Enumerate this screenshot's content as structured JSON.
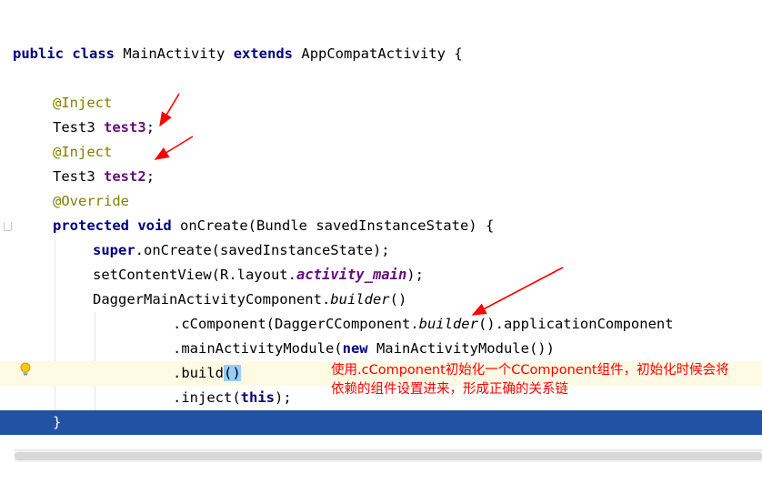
{
  "code": {
    "class_decl": {
      "kw1": "public",
      "kw2": "class",
      "name": "MainActivity",
      "kw3": "extends",
      "parent": "AppCompatActivity",
      "brace": "{"
    },
    "inject1": "@Inject",
    "field1": {
      "type": "Test3",
      "name": "test3",
      "semi": ";"
    },
    "inject2": "@Inject",
    "field2": {
      "type": "Test3",
      "name": "test2",
      "semi": ";"
    },
    "override": "@Override",
    "method_decl": {
      "kw1": "protected",
      "kw2": "void",
      "rest": "onCreate(Bundle savedInstanceState) {"
    },
    "super_call": {
      "kw": "super",
      "rest": ".onCreate(savedInstanceState);"
    },
    "set_content": {
      "pre": "setContentView(R.layout.",
      "ref": "activity_main",
      "post": ");"
    },
    "dagger_builder": {
      "pre": "DaggerMainActivityComponent.",
      "method": "builder",
      "post": "()"
    },
    "ccomponent": {
      "pre": ".cComponent(DaggerCComponent.",
      "method": "builder",
      "post": "().applicationComponent"
    },
    "module": {
      "pre": ".mainActivityModule(",
      "kw": "new",
      "post": " MainActivityModule())"
    },
    "build": {
      "pre": ".build",
      "match": "()"
    },
    "inject_call": {
      "pre": ".inject(",
      "kw": "this",
      "post": ");"
    },
    "closing_brace": "}"
  },
  "annotation": {
    "line1": "使用.cComponent初始化一个CComponent组件，初始化时候会将",
    "line2": "依赖的组件设置进来，形成正确的关系链",
    "color": "#ff0000"
  },
  "icons": {
    "intention": "lightbulb-icon"
  },
  "colors": {
    "keyword": "#000080",
    "annotation": "#808000",
    "field": "#660e7a",
    "selection": "#2152a3",
    "caret_line": "#fffae3"
  }
}
